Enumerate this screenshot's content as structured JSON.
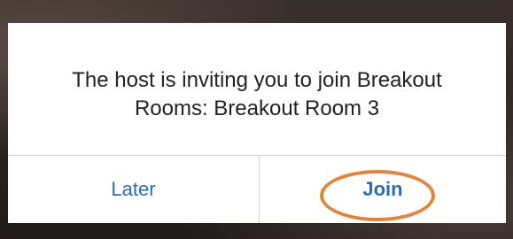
{
  "dialog": {
    "message": "The host is inviting you to join Breakout Rooms: Breakout Room 3",
    "later_label": "Later",
    "join_label": "Join"
  },
  "colors": {
    "button_text": "#2d6cb4",
    "highlight": "#e2843a",
    "divider": "#cfcfcf"
  }
}
